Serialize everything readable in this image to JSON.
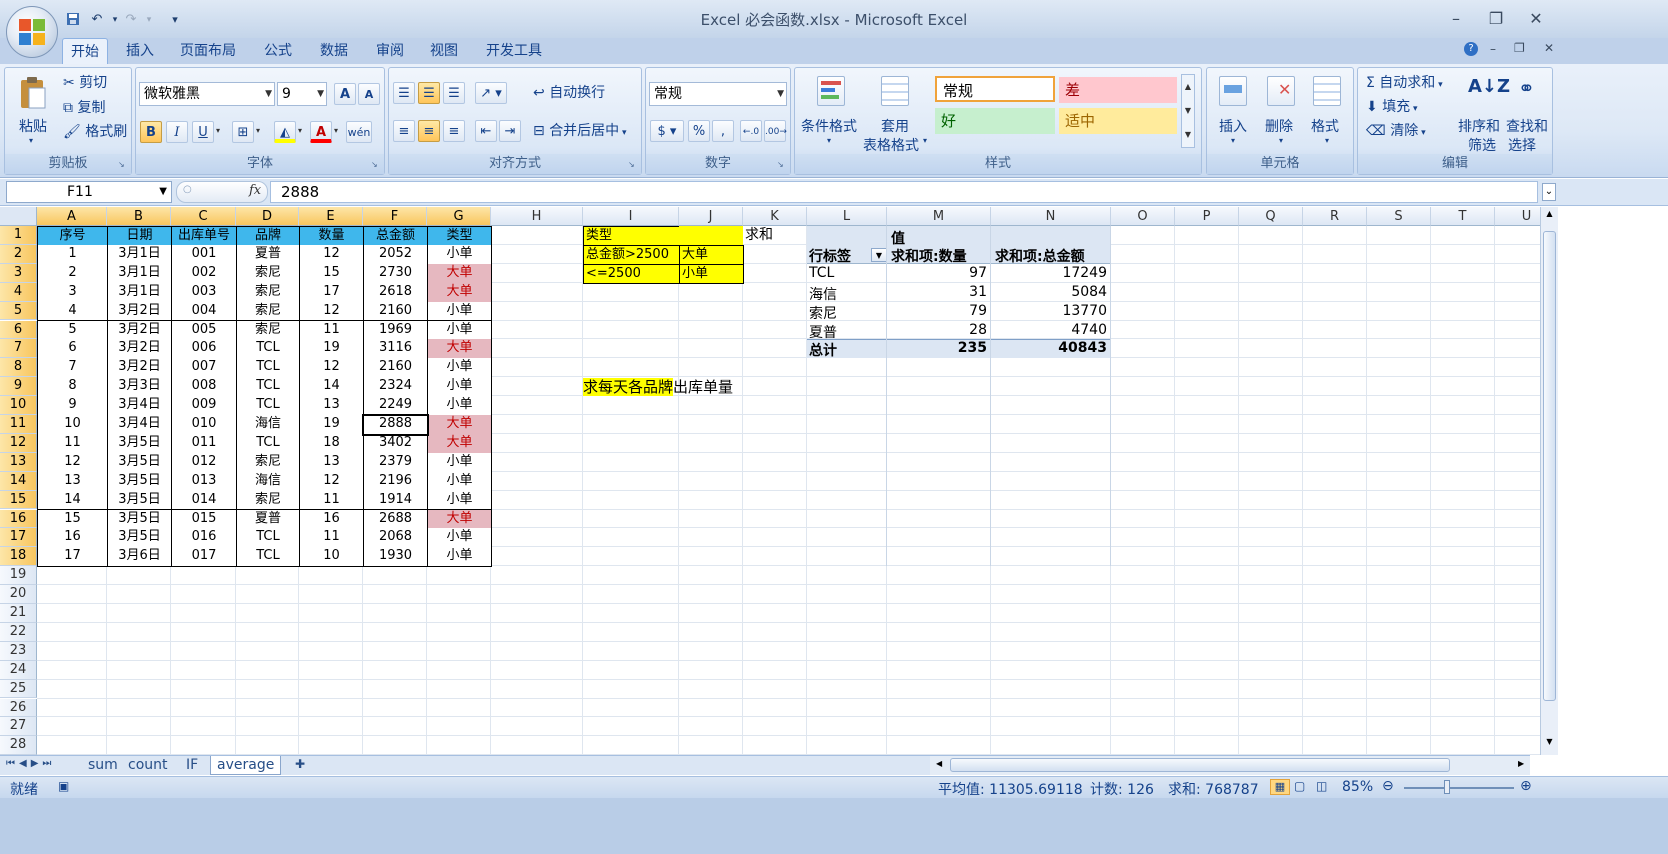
{
  "window": {
    "title": "Excel 必会函数.xlsx - Microsoft Excel",
    "controls": [
      "–",
      "❐",
      "✕"
    ]
  },
  "quick_access": [
    "save-icon",
    "undo-icon",
    "redo-icon",
    "customize-icon"
  ],
  "ribbon_tabs": [
    "开始",
    "插入",
    "页面布局",
    "公式",
    "数据",
    "审阅",
    "视图",
    "开发工具"
  ],
  "ribbon": {
    "clipboard": {
      "label": "剪贴板",
      "paste": "粘贴",
      "cut": "剪切",
      "copy": "复制",
      "format_painter": "格式刷"
    },
    "font": {
      "label": "字体",
      "font_name": "微软雅黑",
      "font_size": "9",
      "grow": "A",
      "shrink": "A",
      "bold": "B",
      "italic": "I",
      "underline": "U",
      "phonetic": "wén"
    },
    "alignment": {
      "label": "对齐方式",
      "wrap": "自动换行",
      "merge": "合并后居中"
    },
    "number": {
      "label": "数字",
      "format": "常规",
      "percent": "%",
      "comma": ",",
      "inc_decimal": "←.0",
      "dec_decimal": ".00→"
    },
    "styles": {
      "label": "样式",
      "conditional": "条件格式",
      "table_format_1": "套用",
      "table_format_2": "表格格式",
      "normal": "常规",
      "bad": "差",
      "good": "好",
      "neutral": "适中"
    },
    "cells": {
      "label": "单元格",
      "insert": "插入",
      "delete": "删除",
      "format": "格式"
    },
    "editing": {
      "label": "编辑",
      "autosum": "自动求和",
      "fill": "填充",
      "clear": "清除",
      "sort_1": "排序和",
      "sort_2": "筛选",
      "find_1": "查找和",
      "find_2": "选择"
    }
  },
  "formula_bar": {
    "name_box": "F11",
    "fx": "fx",
    "value": "2888"
  },
  "columns": [
    "A",
    "B",
    "C",
    "D",
    "E",
    "F",
    "G",
    "H",
    "I",
    "J",
    "K",
    "L",
    "M",
    "N",
    "O",
    "P",
    "Q",
    "R",
    "S",
    "T",
    "U"
  ],
  "rows": [
    "1",
    "2",
    "3",
    "4",
    "5",
    "6",
    "7",
    "8",
    "9",
    "10",
    "11",
    "12",
    "13",
    "14",
    "15",
    "16",
    "17",
    "18",
    "19",
    "20",
    "21",
    "22",
    "23",
    "24",
    "25",
    "26",
    "27",
    "28"
  ],
  "table": {
    "headers": [
      "序号",
      "日期",
      "出库单号",
      "品牌",
      "数量",
      "总金额",
      "类型"
    ],
    "rows": [
      [
        "1",
        "3月1日",
        "001",
        "夏普",
        "12",
        "2052",
        "小单"
      ],
      [
        "2",
        "3月1日",
        "002",
        "索尼",
        "15",
        "2730",
        "大单"
      ],
      [
        "3",
        "3月1日",
        "003",
        "索尼",
        "17",
        "2618",
        "大单"
      ],
      [
        "4",
        "3月2日",
        "004",
        "索尼",
        "12",
        "2160",
        "小单"
      ],
      [
        "5",
        "3月2日",
        "005",
        "索尼",
        "11",
        "1969",
        "小单"
      ],
      [
        "6",
        "3月2日",
        "006",
        "TCL",
        "19",
        "3116",
        "大单"
      ],
      [
        "7",
        "3月2日",
        "007",
        "TCL",
        "12",
        "2160",
        "小单"
      ],
      [
        "8",
        "3月3日",
        "008",
        "TCL",
        "14",
        "2324",
        "小单"
      ],
      [
        "9",
        "3月4日",
        "009",
        "TCL",
        "13",
        "2249",
        "小单"
      ],
      [
        "10",
        "3月4日",
        "010",
        "海信",
        "19",
        "2888",
        "大单"
      ],
      [
        "11",
        "3月5日",
        "011",
        "TCL",
        "18",
        "3402",
        "大单"
      ],
      [
        "12",
        "3月5日",
        "012",
        "索尼",
        "13",
        "2379",
        "小单"
      ],
      [
        "13",
        "3月5日",
        "013",
        "海信",
        "12",
        "2196",
        "小单"
      ],
      [
        "14",
        "3月5日",
        "014",
        "索尼",
        "11",
        "1914",
        "小单"
      ],
      [
        "15",
        "3月5日",
        "015",
        "夏普",
        "16",
        "2688",
        "大单"
      ],
      [
        "16",
        "3月5日",
        "016",
        "TCL",
        "11",
        "2068",
        "小单"
      ],
      [
        "17",
        "3月6日",
        "017",
        "TCL",
        "10",
        "1930",
        "小单"
      ]
    ]
  },
  "criteria": {
    "header": "类型",
    "rows": [
      [
        "总金额>2500",
        "大单"
      ],
      [
        "<=2500",
        "小单"
      ]
    ]
  },
  "k1_text": "求和",
  "note": {
    "highlight": "求每天各品牌",
    "rest": "出库单量"
  },
  "pivot": {
    "values_label": "值",
    "row_label": "行标签",
    "col1": "求和项:数量",
    "col2": "求和项:总金额",
    "rows": [
      [
        "TCL",
        "97",
        "17249"
      ],
      [
        "海信",
        "31",
        "5084"
      ],
      [
        "索尼",
        "79",
        "13770"
      ],
      [
        "夏普",
        "28",
        "4740"
      ]
    ],
    "total": [
      "总计",
      "235",
      "40843"
    ]
  },
  "sheet_tabs": [
    "sum",
    "count",
    "IF",
    "average"
  ],
  "active_sheet": "average",
  "status": {
    "ready": "就绪",
    "average": "平均值: 11305.69118",
    "count": "计数: 126",
    "sum": "求和: 768787",
    "zoom": "85%"
  }
}
